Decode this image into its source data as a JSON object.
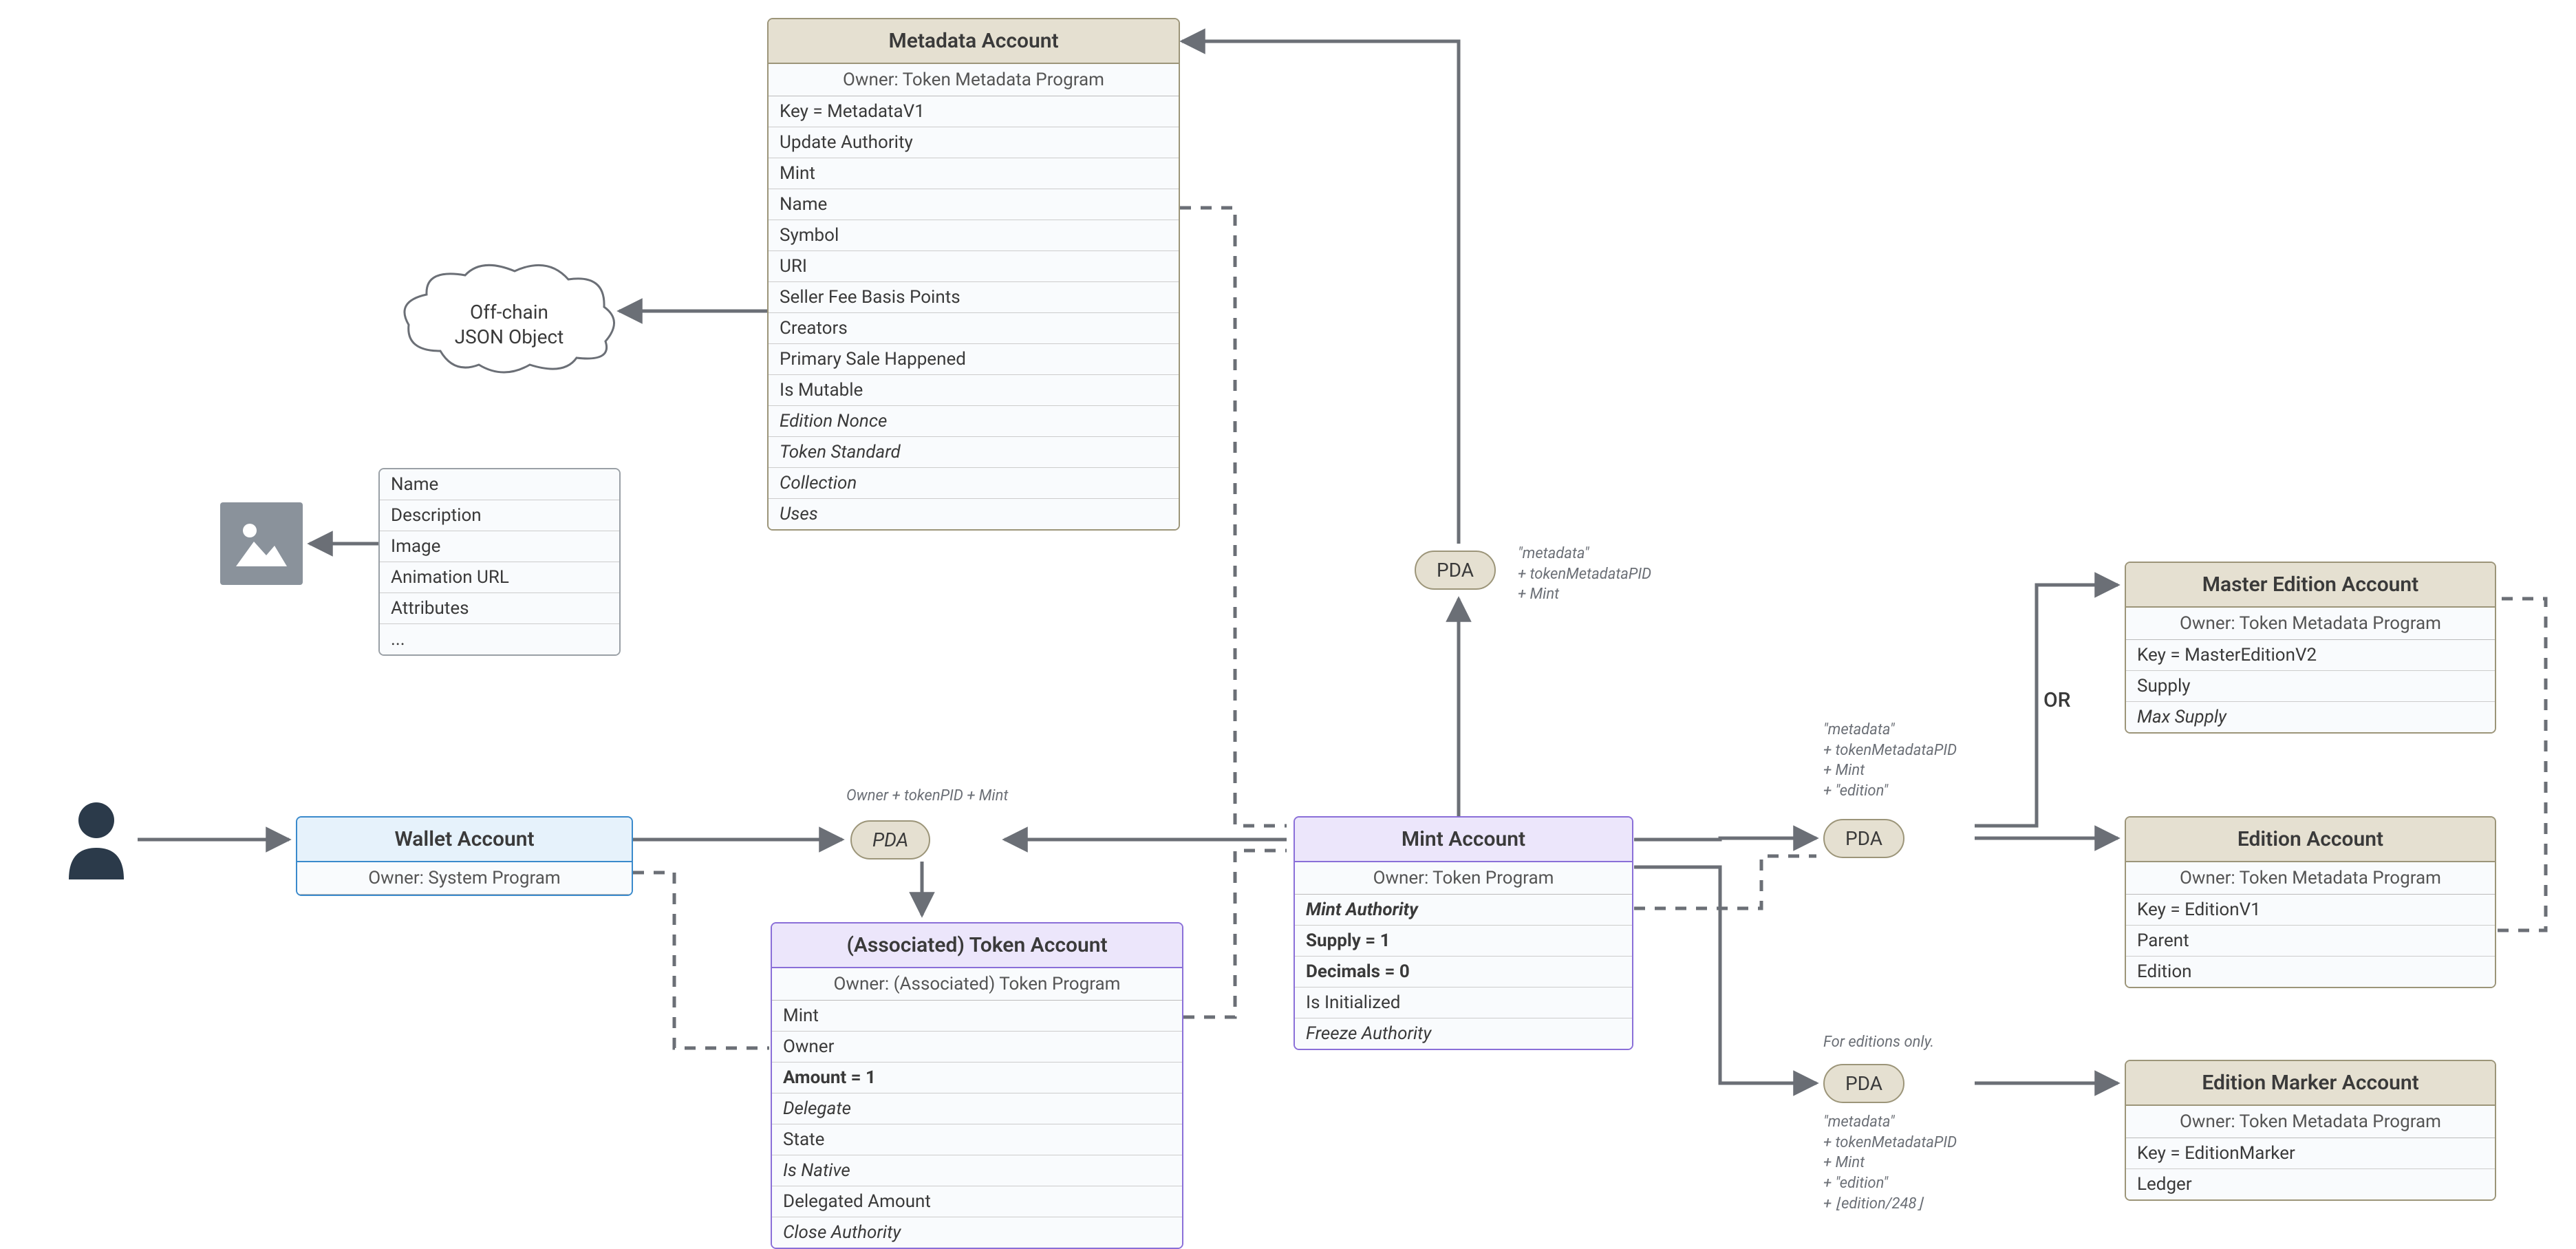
{
  "wallet": {
    "title": "Wallet Account",
    "owner": "Owner: System Program"
  },
  "offchain": {
    "title_l1": "Off-chain",
    "title_l2": "JSON Object",
    "fields": [
      "Name",
      "Description",
      "Image",
      "Animation URL",
      "Attributes",
      "..."
    ]
  },
  "metadata": {
    "title": "Metadata Account",
    "owner": "Owner: Token Metadata Program",
    "fields": [
      {
        "t": "Key = MetadataV1"
      },
      {
        "t": "Update Authority"
      },
      {
        "t": "Mint"
      },
      {
        "t": "Name"
      },
      {
        "t": "Symbol"
      },
      {
        "t": "URI"
      },
      {
        "t": "Seller Fee Basis Points"
      },
      {
        "t": "Creators"
      },
      {
        "t": "Primary Sale Happened"
      },
      {
        "t": "Is Mutable"
      },
      {
        "t": "Edition Nonce",
        "i": true
      },
      {
        "t": "Token Standard",
        "i": true
      },
      {
        "t": "Collection",
        "i": true
      },
      {
        "t": "Uses",
        "i": true
      }
    ]
  },
  "pda_label_top": "Owner + tokenPID + Mint",
  "pda_text": "PDA",
  "ata": {
    "title": "(Associated) Token Account",
    "owner": "Owner: (Associated) Token Program",
    "fields": [
      {
        "t": "Mint"
      },
      {
        "t": "Owner"
      },
      {
        "t": "Amount = 1",
        "b": true
      },
      {
        "t": "Delegate",
        "i": true
      },
      {
        "t": "State"
      },
      {
        "t": "Is Native",
        "i": true
      },
      {
        "t": "Delegated Amount"
      },
      {
        "t": "Close Authority",
        "i": true
      }
    ]
  },
  "mint": {
    "title": "Mint Account",
    "owner": "Owner: Token Program",
    "fields": [
      {
        "t": "Mint Authority",
        "bi": true
      },
      {
        "t": "Supply = 1",
        "b": true
      },
      {
        "t": "Decimals = 0",
        "b": true
      },
      {
        "t": "Is Initialized"
      },
      {
        "t": "Freeze Authority",
        "i": true
      }
    ]
  },
  "pda_meta_seeds": "\"metadata\"\n+ tokenMetadataPID\n+ Mint",
  "pda_edition_seeds": "\"metadata\"\n+ tokenMetadataPID\n+ Mint\n+ \"edition\"",
  "pda_marker_caption": "For editions only.",
  "pda_marker_seeds": "\"metadata\"\n+ tokenMetadataPID\n+ Mint\n+ \"edition\"\n+ ⌊edition/248⌋",
  "or_label": "OR",
  "master": {
    "title": "Master Edition Account",
    "owner": "Owner: Token Metadata Program",
    "fields": [
      {
        "t": "Key = MasterEditionV2"
      },
      {
        "t": "Supply"
      },
      {
        "t": "Max Supply",
        "i": true
      }
    ]
  },
  "edition": {
    "title": "Edition Account",
    "owner": "Owner: Token Metadata Program",
    "fields": [
      {
        "t": "Key = EditionV1"
      },
      {
        "t": "Parent"
      },
      {
        "t": "Edition"
      }
    ]
  },
  "marker": {
    "title": "Edition Marker Account",
    "owner": "Owner: Token Metadata Program",
    "fields": [
      {
        "t": "Key = EditionMarker"
      },
      {
        "t": "Ledger"
      }
    ]
  }
}
